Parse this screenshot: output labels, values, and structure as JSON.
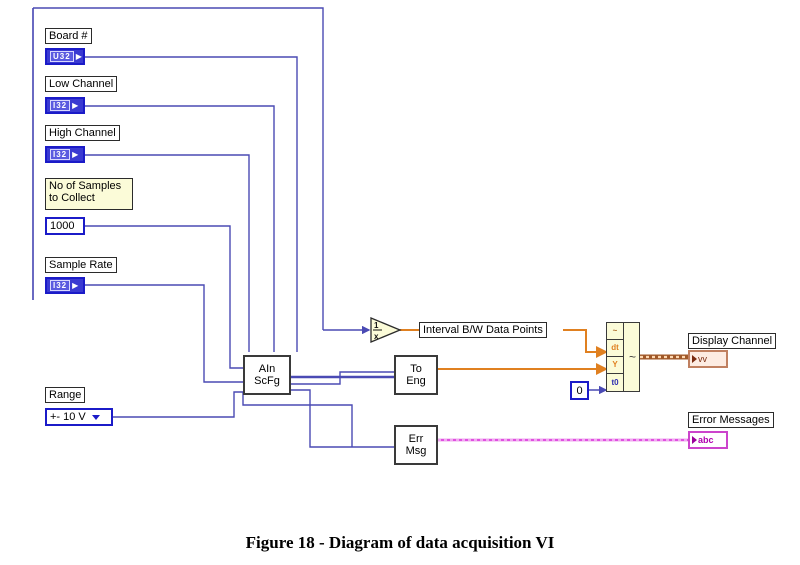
{
  "figure": {
    "caption": "Figure 18 - Diagram of data acquisition VI"
  },
  "diagram": {
    "title": "LabVIEW block diagram — data acquisition VI",
    "controls": [
      {
        "label": "Board #",
        "terminal_type": "U32",
        "value": ""
      },
      {
        "label": "Low Channel",
        "terminal_type": "I32",
        "value": ""
      },
      {
        "label": "High Channel",
        "terminal_type": "I32",
        "value": ""
      },
      {
        "label": "No of Samples to Collect",
        "terminal_type": "numeric",
        "value": "1000"
      },
      {
        "label": "Sample Rate",
        "terminal_type": "I32",
        "value": ""
      },
      {
        "label": "Range",
        "terminal_type": "ring",
        "value": "+- 10 V"
      }
    ],
    "constants": [
      {
        "name": "t0-constant",
        "value": "0"
      }
    ],
    "nodes": [
      {
        "name": "ai-sample-channels",
        "line1": "AIn",
        "line2": "ScFg"
      },
      {
        "name": "to-engineering-units",
        "line1": "To",
        "line2": "Eng"
      },
      {
        "name": "error-message",
        "line1": "Err",
        "line2": "Msg"
      },
      {
        "name": "reciprocal",
        "line1": "1/x",
        "line2": ""
      }
    ],
    "wire_labels": [
      {
        "name": "interval-label",
        "text": "Interval B/W Data Points"
      }
    ],
    "build_waveform": {
      "name": "build-waveform",
      "terminals": [
        "~",
        "dt",
        "Y",
        "t0"
      ],
      "output_glyph": "~"
    },
    "indicators": [
      {
        "label": "Display Channel",
        "terminal_type": "waveform",
        "glyph": "vv"
      },
      {
        "label": "Error Messages",
        "terminal_type": "string",
        "glyph": "abc"
      }
    ],
    "colors": {
      "wire_blue": "#4a4ab4",
      "wire_orange": "#e08020",
      "wire_brown": "#a05828",
      "wire_magenta": "#e050e0",
      "terminal_blue": "#1b1bc8",
      "node_border": "#3a3a3a",
      "cluster_yellow": "#fbfbd8"
    }
  }
}
